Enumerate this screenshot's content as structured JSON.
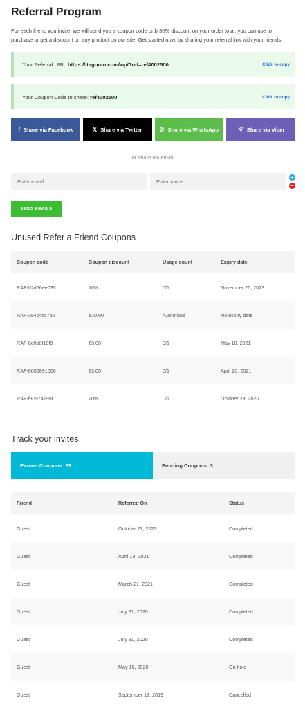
{
  "page": {
    "title": "Referral Program",
    "intro": "For each friend you invite, we will send you a coupon code orth 30% discount on your order total. you can use to purchase or get a discount on any product on our site. Get started now, by sharing your referral link with your friends."
  },
  "referral_url": {
    "label": "Your Referral URL: ",
    "value": "https://itsgoran.com/wp/?raf=ref4002500",
    "copy_label": "Click to copy"
  },
  "coupon_code": {
    "label": "Your Coupon Code to share: ",
    "value": "ref4002500",
    "copy_label": "Click to copy"
  },
  "share": {
    "facebook": "Share via Facebook",
    "twitter": "Share via Twitter",
    "whatsapp": "Share via WhatsApp",
    "viber": "Share via Viber",
    "or_email": "or share via email"
  },
  "email_form": {
    "email_placeholder": "Enter email",
    "name_placeholder": "Enter name",
    "add_label": "+",
    "remove_label": "−",
    "send_label": "SEND EMAILS"
  },
  "coupons": {
    "title": "Unused Refer a Friend Coupons",
    "headers": [
      "Coupon code",
      "Coupon discount",
      "Usage count",
      "Expiry date"
    ],
    "rows": [
      [
        "RAF-02d56ee035",
        "10%",
        "0/1",
        "November 26, 2023"
      ],
      [
        "RAF-394c4cc7b0",
        "€10,00",
        "/Unlimited",
        "No expiry date"
      ],
      [
        "RAF-8c0b8f10f8",
        "€3,00",
        "0/1",
        "May 18, 2021"
      ],
      [
        "RAF-6056891006",
        "€3,00",
        "0/1",
        "April 20, 2021"
      ],
      [
        "RAF-f30974195f",
        "20%",
        "0/1",
        "October 23, 2020"
      ]
    ]
  },
  "invites": {
    "title": "Track your invites",
    "tab_earned": "Earned Coupons: 23",
    "tab_pending": "Pending Coupons: 3",
    "headers": [
      "Friend",
      "Referred On",
      "Status"
    ],
    "rows": [
      [
        "Guest",
        "October 27, 2023",
        "Completed"
      ],
      [
        "Guest",
        "April 18, 2021",
        "Completed"
      ],
      [
        "Guest",
        "March 21, 2021",
        "Completed"
      ],
      [
        "Guest",
        "July 31, 2020",
        "Completed"
      ],
      [
        "Guest",
        "July 31, 2020",
        "Completed"
      ],
      [
        "Guest",
        "May 15, 2020",
        "On hold"
      ],
      [
        "Guest",
        "September 12, 2019",
        "Cancelled"
      ]
    ]
  },
  "colors": {
    "notice_bg": "#eafaea",
    "facebook": "#3b5998",
    "twitter": "#000000",
    "whatsapp": "#5cbd4b",
    "viber": "#6d5fb6",
    "send": "#3dbd33",
    "active_tab": "#00b9d6"
  },
  "icons": {
    "facebook": "facebook-icon",
    "twitter": "x-twitter-icon",
    "whatsapp": "whatsapp-icon",
    "viber": "viber-icon"
  }
}
